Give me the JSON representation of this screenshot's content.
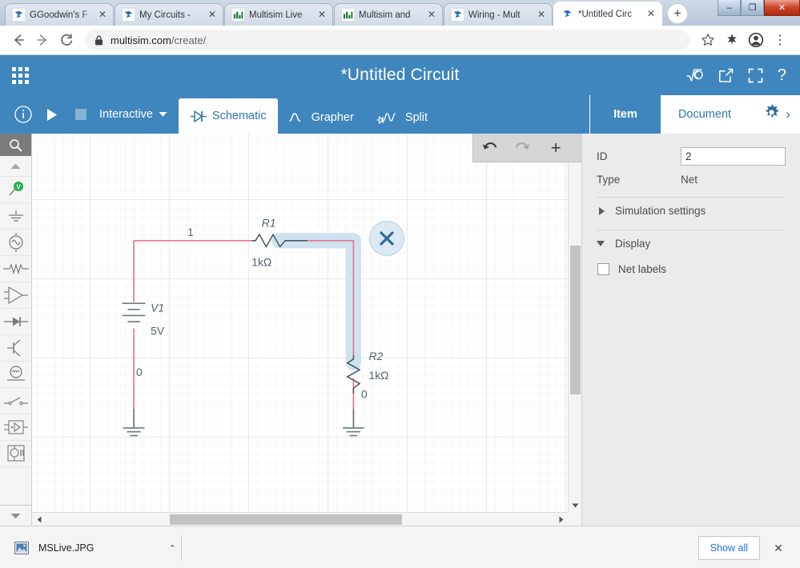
{
  "browser": {
    "tabs": [
      {
        "title": "GGoodwin's F",
        "favicon": "multisim-favicon",
        "active": false
      },
      {
        "title": "My Circuits - ",
        "favicon": "multisim-favicon",
        "active": false
      },
      {
        "title": "Multisim Live",
        "favicon": "ni-favicon",
        "active": false
      },
      {
        "title": "Multisim and ",
        "favicon": "ni-favicon",
        "active": false
      },
      {
        "title": "Wiring - Mult",
        "favicon": "multisim-favicon",
        "active": false
      },
      {
        "title": "*Untitled Circ",
        "favicon": "multisim-favicon",
        "active": true
      }
    ],
    "new_tab_label": "+",
    "close_label": "✕",
    "window_controls": {
      "minimize": "–",
      "restore": "❐",
      "close": "✕"
    },
    "nav": {
      "back": "←",
      "forward": "→",
      "reload": "⟳"
    },
    "omnibox": {
      "lock_icon": "lock-icon",
      "host": "multisim.com",
      "path": "/create/"
    },
    "toolbar_icons": {
      "bookmark": "☆",
      "extensions": "extensions-icon",
      "profile": "profile-icon",
      "menu": "⋮"
    }
  },
  "app_header": {
    "apps_grid": "apps-grid-icon",
    "title": "*Untitled Circuit",
    "actions": [
      {
        "name": "math-formula-icon",
        "glyph": "√Ⓢ"
      },
      {
        "name": "share-icon",
        "glyph": "↗"
      },
      {
        "name": "fullscreen-icon",
        "glyph": "⛶"
      },
      {
        "name": "help-icon",
        "glyph": "?"
      }
    ]
  },
  "toolbar": {
    "info_label": "i",
    "run_label": "▶",
    "stop_label": "■",
    "mode": "Interactive",
    "mode_caret": "▼",
    "view_tabs": [
      {
        "label": "Schematic",
        "icon": "schematic-icon",
        "active": true
      },
      {
        "label": "Grapher",
        "icon": "grapher-icon",
        "active": false
      },
      {
        "label": "Split",
        "icon": "split-icon",
        "active": false
      }
    ]
  },
  "panel": {
    "tabs": [
      {
        "label": "Item",
        "active": true
      },
      {
        "label": "Document",
        "active": false
      }
    ],
    "gear_icon": "gear-icon",
    "expand_icon": "›",
    "properties": {
      "id_label": "ID",
      "id_value": "2",
      "type_label": "Type",
      "type_value": "Net"
    },
    "sections": [
      {
        "label": "Simulation settings",
        "expanded": false
      },
      {
        "label": "Display",
        "expanded": true
      }
    ],
    "display_options": [
      {
        "label": "Net labels",
        "checked": false
      }
    ]
  },
  "left_toolbar": {
    "search_icon": "search-icon",
    "scroll_up": "▲",
    "scroll_down": "▼",
    "tools": [
      {
        "name": "probe-voltage-icon",
        "label": "V"
      },
      {
        "name": "ground-icon",
        "label": ""
      },
      {
        "name": "source-ac-icon",
        "label": ""
      },
      {
        "name": "resistor-icon",
        "label": ""
      },
      {
        "name": "opamp-icon",
        "label": ""
      },
      {
        "name": "diode-icon",
        "label": ""
      },
      {
        "name": "transistor-icon",
        "label": ""
      },
      {
        "name": "lamp-icon",
        "label": ""
      },
      {
        "name": "switch-icon",
        "label": ""
      },
      {
        "name": "digital-ic-icon",
        "label": ""
      },
      {
        "name": "misc-block-icon",
        "label": ""
      }
    ]
  },
  "canvas_toolbar": {
    "undo": "undo-icon",
    "redo": "redo-icon",
    "zoom_in": "+",
    "zoom_out": "−"
  },
  "schematic": {
    "selection": {
      "delete_label": "✕",
      "net_id": "2"
    },
    "components": [
      {
        "ref": "V1",
        "value": "5V",
        "type": "dc-voltage-source"
      },
      {
        "ref": "R1",
        "value": "1kΩ",
        "type": "resistor"
      },
      {
        "ref": "R2",
        "value": "1kΩ",
        "type": "resistor"
      }
    ],
    "net_labels": [
      "1",
      "0",
      "0"
    ],
    "wire_color": "#e8798c",
    "highlight_color": "#cfe2ef"
  },
  "download_bar": {
    "filename": "MSLive.JPG",
    "file_icon": "image-file-icon",
    "caret": "⌃",
    "show_all": "Show all",
    "close": "✕"
  },
  "colors": {
    "brand_blue": "#3f86bf",
    "panel_bg": "#ebebeb",
    "wire": "#e8798c",
    "link": "#1a73e8"
  }
}
